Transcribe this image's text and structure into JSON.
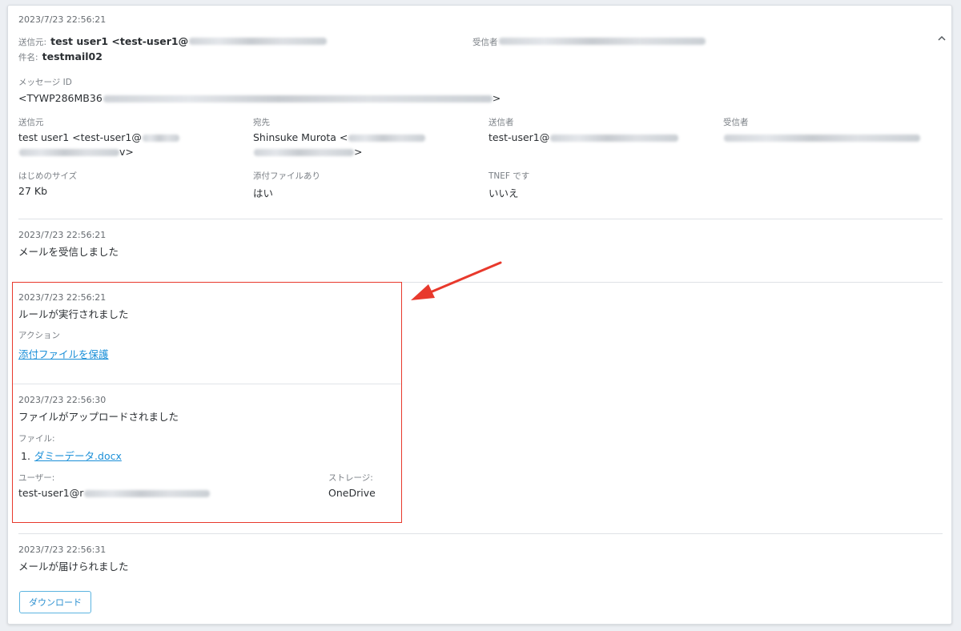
{
  "header": {
    "timestamp": "2023/7/23 22:56:21",
    "sender_label": "送信元:",
    "sender_value": "test user1 <test-user1@",
    "recipient_label": "受信者",
    "subject_label": "件名:",
    "subject_value": "testmail02"
  },
  "message_id": {
    "label": "メッセージ ID",
    "value_prefix": "<TYWP286MB36",
    "value_suffix": ">"
  },
  "details": {
    "from_label": "送信元",
    "from_line1": "test user1 <test-user1@",
    "from_line2_suffix": "v>",
    "to_label": "宛先",
    "to_line1": "Shinsuke Murota <",
    "to_line2_suffix": ">",
    "sender_label": "送信者",
    "sender_value": "test-user1@",
    "recipient_label": "受信者",
    "size_label": "はじめのサイズ",
    "size_value": "27 Kb",
    "attachment_label": "添付ファイルあり",
    "attachment_value": "はい",
    "tnef_label": "TNEF です",
    "tnef_value": "いいえ"
  },
  "events": [
    {
      "timestamp": "2023/7/23 22:56:21",
      "title": "メールを受信しました"
    },
    {
      "timestamp": "2023/7/23 22:56:21",
      "title": "ルールが実行されました",
      "action_label": "アクション",
      "action_link": "添付ファイルを保護"
    },
    {
      "timestamp": "2023/7/23 22:56:30",
      "title": "ファイルがアップロードされました",
      "file_label": "ファイル:",
      "file_index": "1.",
      "file_name": "ダミーデータ.docx",
      "user_label": "ユーザー:",
      "user_value": "test-user1@r",
      "storage_label": "ストレージ:",
      "storage_value": "OneDrive"
    },
    {
      "timestamp": "2023/7/23 22:56:31",
      "title": "メールが届けられました"
    }
  ],
  "download_button": "ダウンロード",
  "colors": {
    "highlight_border": "#e8392c",
    "arrow": "#e8392c",
    "link": "#1a8fd8",
    "button_border": "#5bb4e0"
  },
  "icons": {
    "collapse": "chevron-up-icon",
    "annotation": "red-arrow-icon"
  }
}
